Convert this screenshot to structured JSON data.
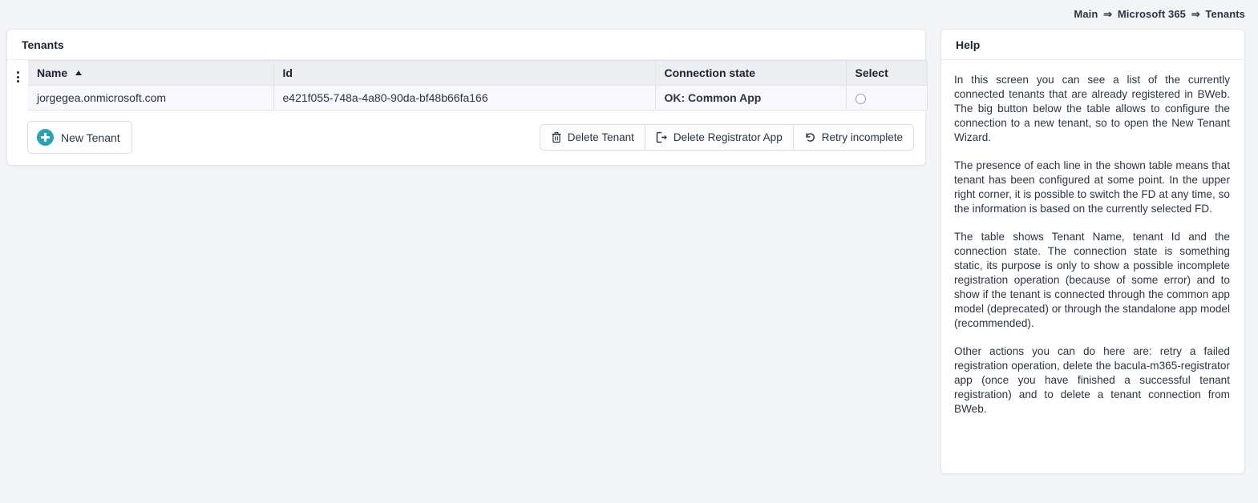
{
  "breadcrumb": {
    "separator": "⇒",
    "items": [
      "Main",
      "Microsoft 365",
      "Tenants"
    ]
  },
  "tenants_panel": {
    "title": "Tenants",
    "column_menu_icon": "three-dots-vertical-icon",
    "table": {
      "columns": [
        "Name",
        "Id",
        "Connection state",
        "Select"
      ],
      "sort": {
        "column": "Name",
        "direction": "asc",
        "icon": "caret-up-icon"
      },
      "rows": [
        {
          "name": "jorgegea.onmicrosoft.com",
          "id": "e421f055-748a-4a80-90da-bf48b66fa166",
          "connection_state": "OK: Common App",
          "state_color": "#28b446",
          "selected": false
        }
      ]
    },
    "primary_action": {
      "label": "New Tenant",
      "icon": "plus-circle-icon",
      "icon_color": "#27a4b2"
    },
    "actions": [
      {
        "label": "Delete Tenant",
        "icon": "trash-icon"
      },
      {
        "label": "Delete Registrator App",
        "icon": "sign-out-icon"
      },
      {
        "label": "Retry incomplete",
        "icon": "rotate-left-icon"
      }
    ]
  },
  "help_panel": {
    "title": "Help",
    "paragraphs": [
      "In this screen you can see a list of the currently connected tenants that are already registered in BWeb. The big button below the table allows to configure the connection to a new tenant, so to open the New Tenant Wizard.",
      "The presence of each line in the shown table means that tenant has been configured at some point. In the upper right corner, it is possible to switch the FD at any time, so the information is based on the currently selected FD.",
      "The table shows Tenant Name, tenant Id and the connection state. The connection state is something static, its purpose is only to show a possible incomplete registration operation (because of some error) and to show if the tenant is connected through the common app model (deprecated) or through the standalone app model (recommended).",
      "Other actions you can do here are: retry a failed registration operation, delete the bacula-m365-registrator app (once you have finished a successful tenant registration) and to delete a tenant connection from BWeb."
    ]
  }
}
